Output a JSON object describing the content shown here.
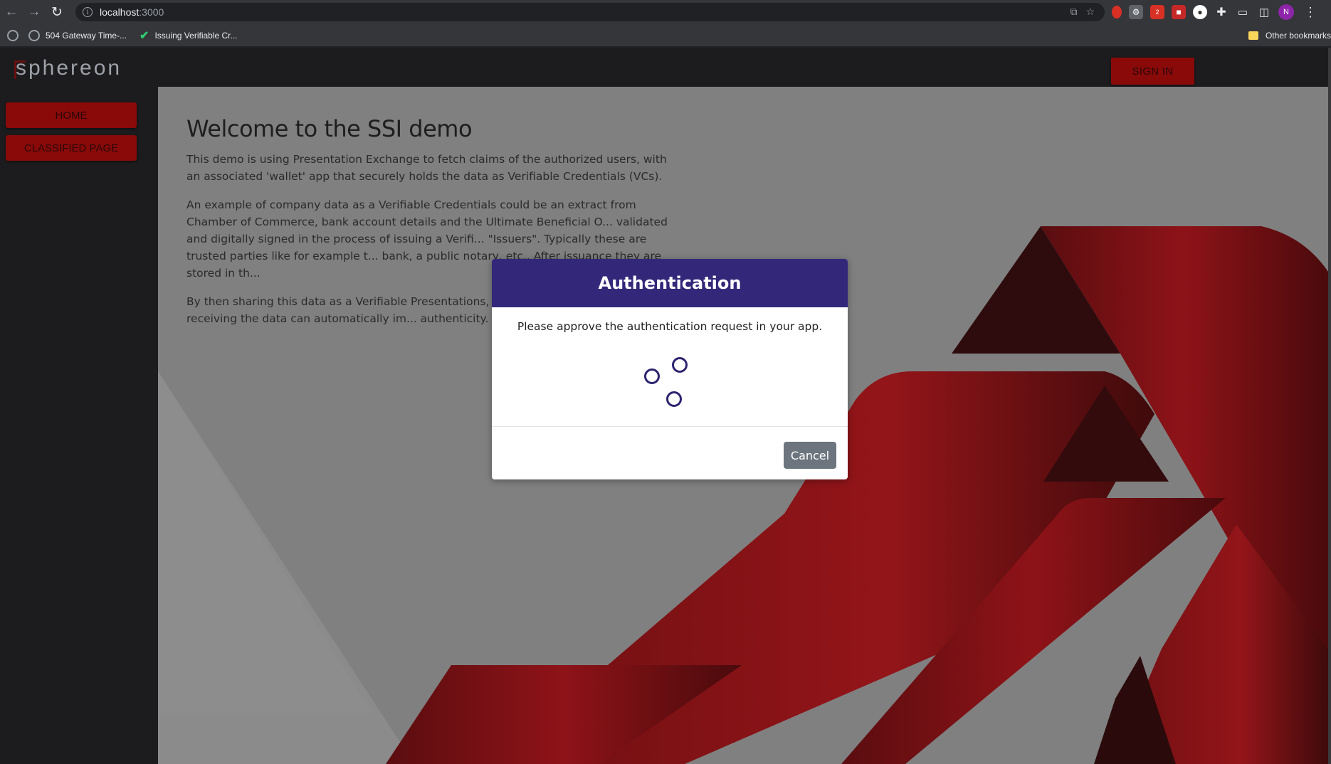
{
  "browser": {
    "url_host": "localhost",
    "url_port": ":3000",
    "bookmarks": [
      {
        "label": "504 Gateway Time-..."
      },
      {
        "label": "Issuing Verifiable Cr..."
      }
    ],
    "other_bookmarks": "Other bookmarks",
    "profile_initial": "N"
  },
  "app": {
    "logo": "sphereon",
    "signin_label": "SIGN IN",
    "nav": [
      {
        "label": "HOME"
      },
      {
        "label": "CLASSIFIED PAGE"
      }
    ],
    "accent_color": "#8a0a0a"
  },
  "main": {
    "title": "Welcome to the SSI demo",
    "paragraphs": [
      "This demo is using Presentation Exchange to fetch claims of the authorized users, with an associated 'wallet' app that securely holds the data as Verifiable Credentials (VCs).",
      "An example of company data as a Verifiable Credentials could be an extract from Chamber of Commerce, bank account details and the Ultimate Beneficial O... validated and digitally signed in the process of issuing a Verifi... \"Issuers\". Typically these are trusted parties like for example t... bank, a public notary, etc.. After issuance they are stored in th...",
      "By then sharing this data as a Verifiable Presentations, the rec... for example a Telco – receiving the data can automatically im... authenticity."
    ]
  },
  "modal": {
    "title": "Authentication",
    "message": "Please approve the authentication request in your app.",
    "cancel_label": "Cancel",
    "header_color": "#33277a"
  }
}
